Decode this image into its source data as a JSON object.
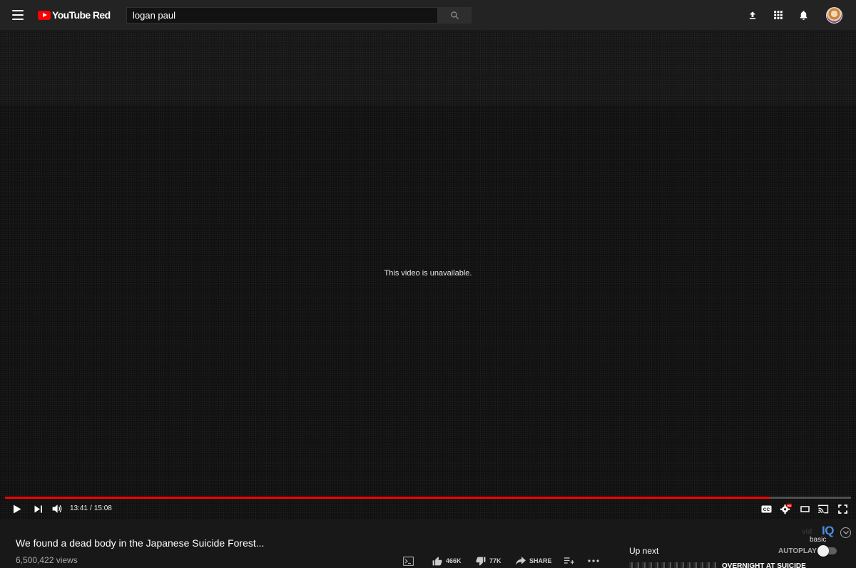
{
  "masthead": {
    "logo_text": "YouTube Red",
    "search_value": "logan paul"
  },
  "player": {
    "message": "This video is unavailable.",
    "current_time": "13:41",
    "duration": "15:08",
    "progress": 0.904
  },
  "video": {
    "title": "We found a dead body in the Japanese Suicide Forest...",
    "views": "6,500,422 views"
  },
  "actions": {
    "likes": "466K",
    "dislikes": "77K",
    "share": "SHARE"
  },
  "vidiq": {
    "brand_left": "vid",
    "brand_right": "IQ",
    "plan": "basic"
  },
  "sidebar": {
    "up_next": "Up next",
    "autoplay": "AUTOPLAY",
    "next_video_title": "OVERNIGHT AT SUICIDE"
  },
  "colors": {
    "progress": "#ff0000",
    "vidiq_accent": "#4a8fe0"
  }
}
